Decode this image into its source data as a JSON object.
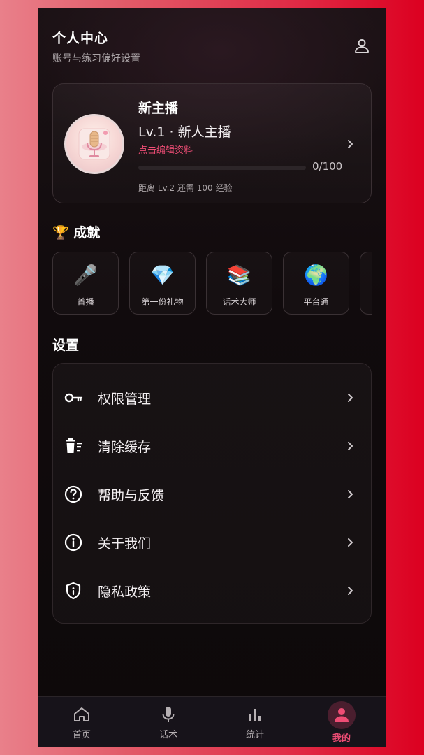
{
  "header": {
    "title": "个人中心",
    "subtitle": "账号与练习偏好设置",
    "user_icon": "user-icon"
  },
  "profile": {
    "name": "新主播",
    "level": "Lv.1 · 新人主播",
    "edit_label": "点击编辑资料",
    "progress_text": "0/100",
    "progress_fraction": 0,
    "next_level_text": "距离 Lv.2 还需 100 经验",
    "avatar_icon": "microphone-avatar"
  },
  "achievements": {
    "title": "成就",
    "title_icon": "trophy-icon",
    "items": [
      {
        "icon": "🎤",
        "label": "首播"
      },
      {
        "icon": "💎",
        "label": "第一份礼物"
      },
      {
        "icon": "📚",
        "label": "话术大师"
      },
      {
        "icon": "🌍",
        "label": "平台通"
      }
    ]
  },
  "settings": {
    "title": "设置",
    "items": [
      {
        "icon": "key-icon",
        "label": "权限管理"
      },
      {
        "icon": "trash-icon",
        "label": "清除缓存"
      },
      {
        "icon": "help-icon",
        "label": "帮助与反馈"
      },
      {
        "icon": "info-icon",
        "label": "关于我们"
      },
      {
        "icon": "shield-icon",
        "label": "隐私政策"
      }
    ]
  },
  "tabbar": {
    "items": [
      {
        "icon": "home-icon",
        "label": "首页"
      },
      {
        "icon": "microphone-icon",
        "label": "话术"
      },
      {
        "icon": "bar-chart-icon",
        "label": "统计"
      },
      {
        "icon": "person-icon",
        "label": "我的"
      }
    ],
    "active_index": 3
  },
  "colors": {
    "accent": "#ee4d75",
    "background": "#110b0d"
  }
}
